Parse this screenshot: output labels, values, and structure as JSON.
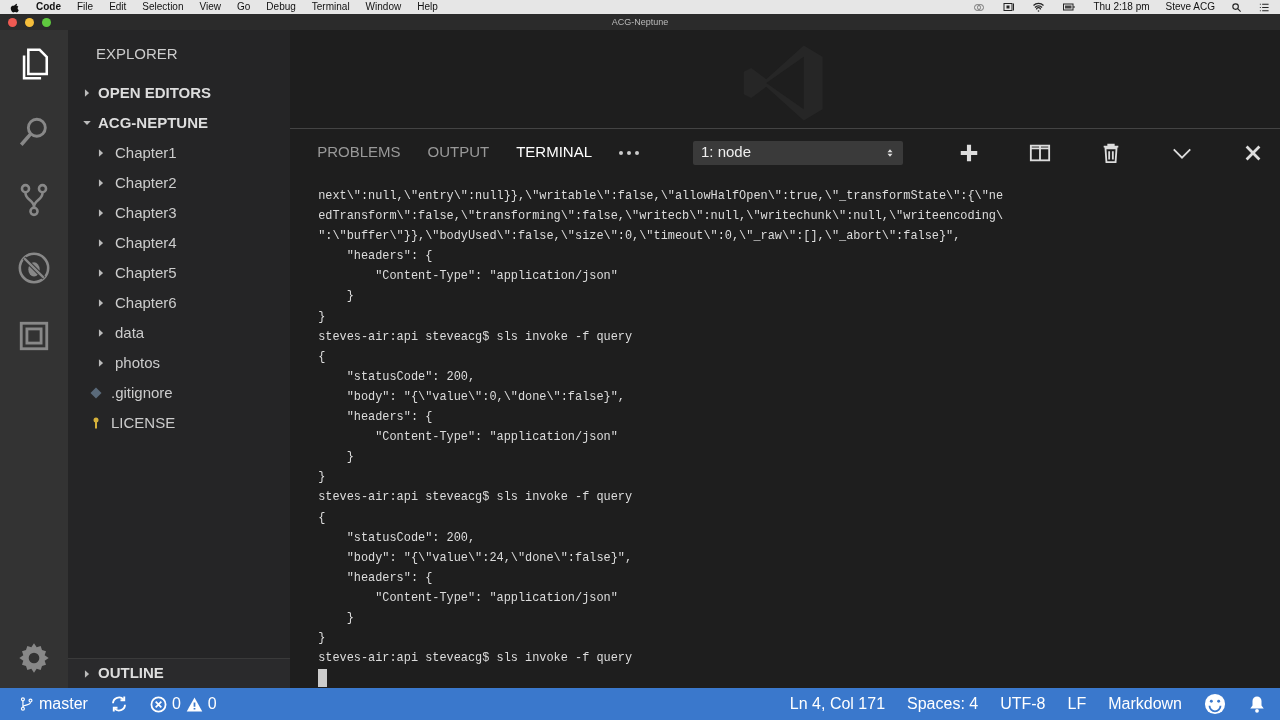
{
  "menubar": {
    "app": "Code",
    "items": [
      "File",
      "Edit",
      "Selection",
      "View",
      "Go",
      "Debug",
      "Terminal",
      "Window",
      "Help"
    ],
    "clock": "Thu 2:18 pm",
    "user": "Steve ACG"
  },
  "window": {
    "title": "ACG-Neptune"
  },
  "activity_bar": [
    {
      "kind": "files",
      "selected": true
    },
    {
      "kind": "search",
      "selected": false
    },
    {
      "kind": "scm",
      "selected": false
    },
    {
      "kind": "debug",
      "selected": false
    },
    {
      "kind": "extensions",
      "selected": false
    }
  ],
  "sidebar": {
    "title": "EXPLORER",
    "sections": [
      {
        "label": "OPEN EDITORS",
        "expanded": false
      },
      {
        "label": "ACG-NEPTUNE",
        "expanded": true,
        "children": [
          {
            "label": "Chapter1",
            "kind": "folder",
            "expanded": false
          },
          {
            "label": "Chapter2",
            "kind": "folder",
            "expanded": false
          },
          {
            "label": "Chapter3",
            "kind": "folder",
            "expanded": false
          },
          {
            "label": "Chapter4",
            "kind": "folder",
            "expanded": false
          },
          {
            "label": "Chapter5",
            "kind": "folder",
            "expanded": false
          },
          {
            "label": "Chapter6",
            "kind": "folder",
            "expanded": false
          },
          {
            "label": "data",
            "kind": "folder",
            "expanded": false
          },
          {
            "label": "photos",
            "kind": "folder",
            "expanded": false
          },
          {
            "label": ".gitignore",
            "kind": "gitfile"
          },
          {
            "label": "LICENSE",
            "kind": "license"
          }
        ]
      }
    ],
    "outline": {
      "label": "OUTLINE",
      "expanded": false
    }
  },
  "panel": {
    "tabs": [
      {
        "label": "PROBLEMS",
        "selected": false
      },
      {
        "label": "OUTPUT",
        "selected": false
      },
      {
        "label": "TERMINAL",
        "selected": true
      }
    ],
    "terminal_select": "1: node",
    "lines": [
      "next\\\":null,\\\"entry\\\":null}},\\\"writable\\\":false,\\\"allowHalfOpen\\\":true,\\\"_transformState\\\":{\\\"ne",
      "edTransform\\\":false,\\\"transforming\\\":false,\\\"writecb\\\":null,\\\"writechunk\\\":null,\\\"writeencoding\\",
      "\":\\\"buffer\\\"}},\\\"bodyUsed\\\":false,\\\"size\\\":0,\\\"timeout\\\":0,\\\"_raw\\\":[],\\\"_abort\\\":false}\",",
      "    \"headers\": {",
      "        \"Content-Type\": \"application/json\"",
      "    }",
      "}",
      "steves-air:api steveacg$ sls invoke -f query",
      "{",
      "    \"statusCode\": 200,",
      "    \"body\": \"{\\\"value\\\":0,\\\"done\\\":false}\",",
      "    \"headers\": {",
      "        \"Content-Type\": \"application/json\"",
      "    }",
      "}",
      "steves-air:api steveacg$ sls invoke -f query",
      "{",
      "    \"statusCode\": 200,",
      "    \"body\": \"{\\\"value\\\":24,\\\"done\\\":false}\",",
      "    \"headers\": {",
      "        \"Content-Type\": \"application/json\"",
      "    }",
      "}",
      "steves-air:api steveacg$ sls invoke -f query"
    ]
  },
  "status_bar": {
    "branch": "master",
    "errors": "0",
    "warnings": "0",
    "position": "Ln 4, Col 171",
    "indentation": "Spaces: 4",
    "encoding": "UTF-8",
    "eol": "LF",
    "language": "Markdown"
  }
}
